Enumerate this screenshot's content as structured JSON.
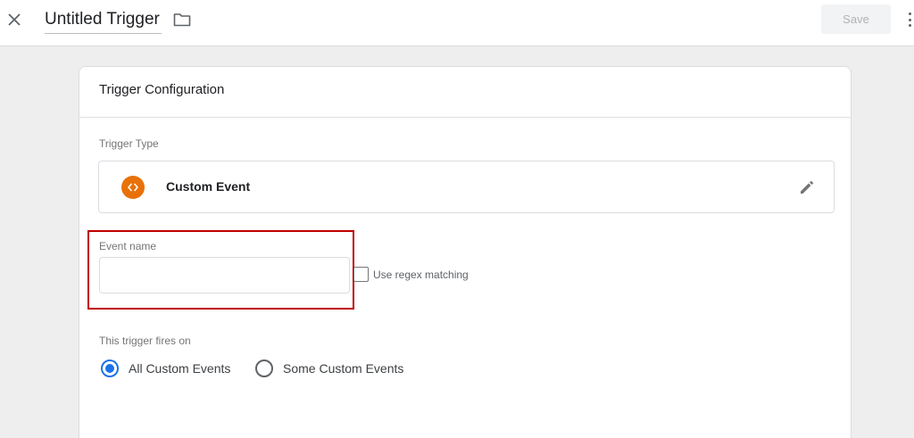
{
  "header": {
    "title": "Untitled Trigger",
    "save_label": "Save",
    "icons": {
      "close": "close-icon",
      "folder": "folder-icon",
      "more": "more-vert-icon"
    }
  },
  "card": {
    "title": "Trigger Configuration",
    "trigger_type": {
      "label": "Trigger Type",
      "name": "Custom Event",
      "icon": "code-brackets-icon",
      "icon_color": "#e8710a"
    },
    "event_name": {
      "label": "Event name",
      "value": "",
      "placeholder": ""
    },
    "regex": {
      "label": "Use regex matching",
      "checked": false
    },
    "fires_on": {
      "label": "This trigger fires on",
      "options": [
        {
          "label": "All Custom Events",
          "selected": true
        },
        {
          "label": "Some Custom Events",
          "selected": false
        }
      ]
    }
  },
  "colors": {
    "accent": "#1a73e8",
    "highlight_border": "#c00000",
    "page_bg": "#eeeeee"
  }
}
